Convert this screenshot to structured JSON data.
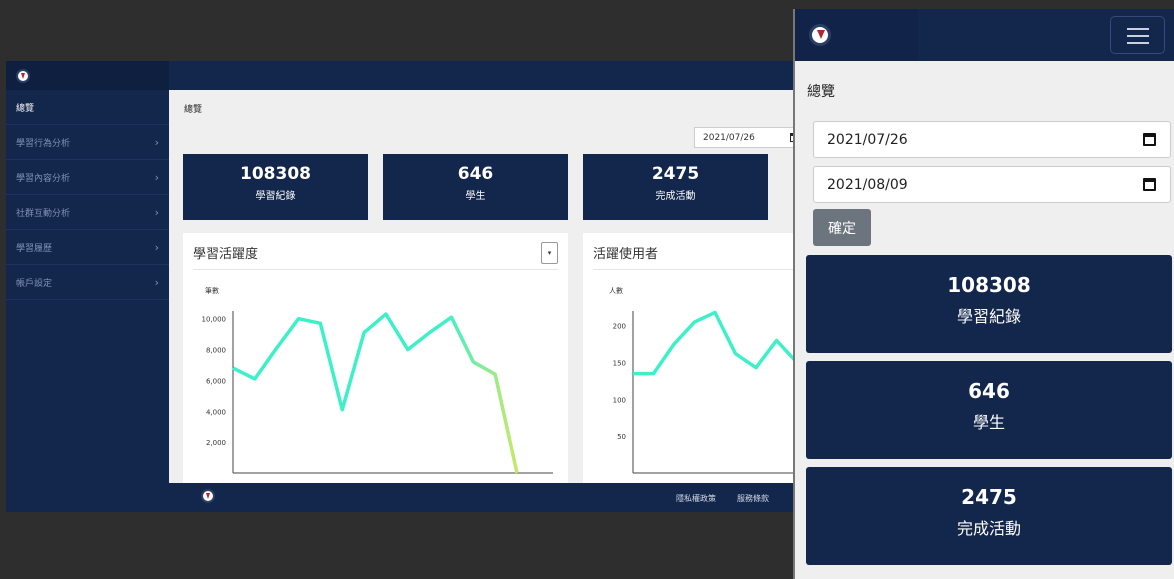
{
  "desktop": {
    "sidebar": {
      "items": [
        {
          "label": "總覽",
          "active": true
        },
        {
          "label": "學習行為分析"
        },
        {
          "label": "學習內容分析"
        },
        {
          "label": "社群互動分析"
        },
        {
          "label": "學習履歷"
        },
        {
          "label": "帳戶設定"
        }
      ]
    },
    "breadcrumb": "總覽",
    "start_date": "2021/07/26",
    "stats": [
      {
        "value": "108308",
        "label": "學習紀錄"
      },
      {
        "value": "646",
        "label": "學生"
      },
      {
        "value": "2475",
        "label": "完成活動"
      }
    ],
    "cards": {
      "activity_title": "學習活躍度",
      "users_title": "活躍使用者"
    },
    "footer": {
      "privacy": "隱私權政策",
      "terms": "服務條款"
    }
  },
  "mobile": {
    "title": "總覽",
    "start_date": "2021/07/26",
    "end_date": "2021/08/09",
    "confirm": "確定",
    "stats": [
      {
        "value": "108308",
        "label": "學習紀錄"
      },
      {
        "value": "646",
        "label": "學生"
      },
      {
        "value": "2475",
        "label": "完成活動"
      }
    ]
  },
  "chart_data": [
    {
      "type": "line",
      "ylabel": "筆數",
      "yticks": [
        2000,
        4000,
        6000,
        8000,
        10000
      ],
      "ytick_labels": [
        "2,000",
        "4,000",
        "6,000",
        "8,000",
        "10,000"
      ],
      "ylim": [
        0,
        10500
      ],
      "y": [
        6800,
        6100,
        8100,
        10000,
        9700,
        4100,
        9100,
        10300,
        8000,
        9100,
        10100,
        7200,
        6400,
        0
      ],
      "colors": [
        "#3ef0c8",
        "#c6e86a"
      ]
    },
    {
      "type": "line",
      "ylabel": "人數",
      "yticks": [
        50,
        100,
        150,
        200
      ],
      "ytick_labels": [
        "50",
        "100",
        "150",
        "200"
      ],
      "ylim": [
        0,
        220
      ],
      "y": [
        135,
        135,
        175,
        205,
        218,
        162,
        143,
        180,
        150
      ],
      "colors": [
        "#3ef0c8"
      ]
    }
  ],
  "colors": {
    "navy": "#13264b",
    "page_bg": "#efefef",
    "chart_line": "#3ef0c8",
    "button_gray": "#6c757d"
  }
}
